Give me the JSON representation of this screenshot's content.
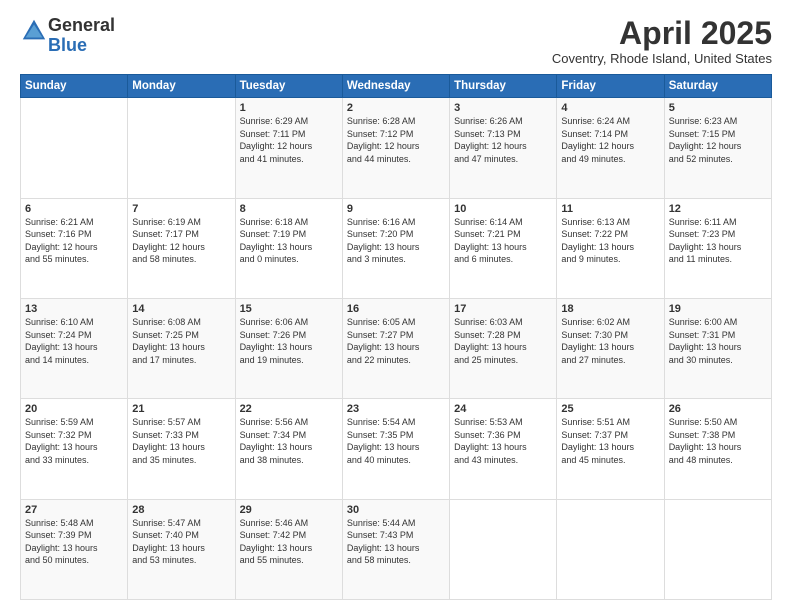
{
  "logo": {
    "general": "General",
    "blue": "Blue"
  },
  "header": {
    "month": "April 2025",
    "location": "Coventry, Rhode Island, United States"
  },
  "days_of_week": [
    "Sunday",
    "Monday",
    "Tuesday",
    "Wednesday",
    "Thursday",
    "Friday",
    "Saturday"
  ],
  "weeks": [
    [
      {
        "day": "",
        "info": ""
      },
      {
        "day": "",
        "info": ""
      },
      {
        "day": "1",
        "info": "Sunrise: 6:29 AM\nSunset: 7:11 PM\nDaylight: 12 hours\nand 41 minutes."
      },
      {
        "day": "2",
        "info": "Sunrise: 6:28 AM\nSunset: 7:12 PM\nDaylight: 12 hours\nand 44 minutes."
      },
      {
        "day": "3",
        "info": "Sunrise: 6:26 AM\nSunset: 7:13 PM\nDaylight: 12 hours\nand 47 minutes."
      },
      {
        "day": "4",
        "info": "Sunrise: 6:24 AM\nSunset: 7:14 PM\nDaylight: 12 hours\nand 49 minutes."
      },
      {
        "day": "5",
        "info": "Sunrise: 6:23 AM\nSunset: 7:15 PM\nDaylight: 12 hours\nand 52 minutes."
      }
    ],
    [
      {
        "day": "6",
        "info": "Sunrise: 6:21 AM\nSunset: 7:16 PM\nDaylight: 12 hours\nand 55 minutes."
      },
      {
        "day": "7",
        "info": "Sunrise: 6:19 AM\nSunset: 7:17 PM\nDaylight: 12 hours\nand 58 minutes."
      },
      {
        "day": "8",
        "info": "Sunrise: 6:18 AM\nSunset: 7:19 PM\nDaylight: 13 hours\nand 0 minutes."
      },
      {
        "day": "9",
        "info": "Sunrise: 6:16 AM\nSunset: 7:20 PM\nDaylight: 13 hours\nand 3 minutes."
      },
      {
        "day": "10",
        "info": "Sunrise: 6:14 AM\nSunset: 7:21 PM\nDaylight: 13 hours\nand 6 minutes."
      },
      {
        "day": "11",
        "info": "Sunrise: 6:13 AM\nSunset: 7:22 PM\nDaylight: 13 hours\nand 9 minutes."
      },
      {
        "day": "12",
        "info": "Sunrise: 6:11 AM\nSunset: 7:23 PM\nDaylight: 13 hours\nand 11 minutes."
      }
    ],
    [
      {
        "day": "13",
        "info": "Sunrise: 6:10 AM\nSunset: 7:24 PM\nDaylight: 13 hours\nand 14 minutes."
      },
      {
        "day": "14",
        "info": "Sunrise: 6:08 AM\nSunset: 7:25 PM\nDaylight: 13 hours\nand 17 minutes."
      },
      {
        "day": "15",
        "info": "Sunrise: 6:06 AM\nSunset: 7:26 PM\nDaylight: 13 hours\nand 19 minutes."
      },
      {
        "day": "16",
        "info": "Sunrise: 6:05 AM\nSunset: 7:27 PM\nDaylight: 13 hours\nand 22 minutes."
      },
      {
        "day": "17",
        "info": "Sunrise: 6:03 AM\nSunset: 7:28 PM\nDaylight: 13 hours\nand 25 minutes."
      },
      {
        "day": "18",
        "info": "Sunrise: 6:02 AM\nSunset: 7:30 PM\nDaylight: 13 hours\nand 27 minutes."
      },
      {
        "day": "19",
        "info": "Sunrise: 6:00 AM\nSunset: 7:31 PM\nDaylight: 13 hours\nand 30 minutes."
      }
    ],
    [
      {
        "day": "20",
        "info": "Sunrise: 5:59 AM\nSunset: 7:32 PM\nDaylight: 13 hours\nand 33 minutes."
      },
      {
        "day": "21",
        "info": "Sunrise: 5:57 AM\nSunset: 7:33 PM\nDaylight: 13 hours\nand 35 minutes."
      },
      {
        "day": "22",
        "info": "Sunrise: 5:56 AM\nSunset: 7:34 PM\nDaylight: 13 hours\nand 38 minutes."
      },
      {
        "day": "23",
        "info": "Sunrise: 5:54 AM\nSunset: 7:35 PM\nDaylight: 13 hours\nand 40 minutes."
      },
      {
        "day": "24",
        "info": "Sunrise: 5:53 AM\nSunset: 7:36 PM\nDaylight: 13 hours\nand 43 minutes."
      },
      {
        "day": "25",
        "info": "Sunrise: 5:51 AM\nSunset: 7:37 PM\nDaylight: 13 hours\nand 45 minutes."
      },
      {
        "day": "26",
        "info": "Sunrise: 5:50 AM\nSunset: 7:38 PM\nDaylight: 13 hours\nand 48 minutes."
      }
    ],
    [
      {
        "day": "27",
        "info": "Sunrise: 5:48 AM\nSunset: 7:39 PM\nDaylight: 13 hours\nand 50 minutes."
      },
      {
        "day": "28",
        "info": "Sunrise: 5:47 AM\nSunset: 7:40 PM\nDaylight: 13 hours\nand 53 minutes."
      },
      {
        "day": "29",
        "info": "Sunrise: 5:46 AM\nSunset: 7:42 PM\nDaylight: 13 hours\nand 55 minutes."
      },
      {
        "day": "30",
        "info": "Sunrise: 5:44 AM\nSunset: 7:43 PM\nDaylight: 13 hours\nand 58 minutes."
      },
      {
        "day": "",
        "info": ""
      },
      {
        "day": "",
        "info": ""
      },
      {
        "day": "",
        "info": ""
      }
    ]
  ]
}
